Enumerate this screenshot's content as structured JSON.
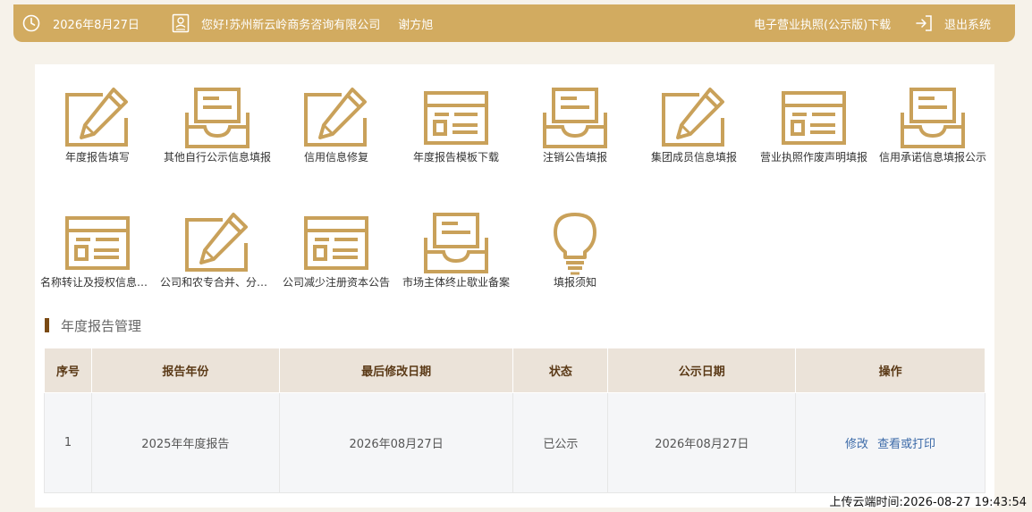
{
  "header": {
    "date": "2026年8月27日",
    "greeting": "您好!苏州新云岭商务咨询有限公司",
    "user_name": "谢方旭",
    "license_download": "电子营业执照(公示版)下载",
    "logout": "退出系统"
  },
  "tiles": [
    {
      "label": "年度报告填写",
      "icon": "pencil-icon"
    },
    {
      "label": "其他自行公示信息填报",
      "icon": "inbox-icon"
    },
    {
      "label": "信用信息修复",
      "icon": "pencil-icon"
    },
    {
      "label": "年度报告模板下载",
      "icon": "form-icon"
    },
    {
      "label": "注销公告填报",
      "icon": "inbox-icon"
    },
    {
      "label": "集团成员信息填报",
      "icon": "pencil-icon"
    },
    {
      "label": "营业执照作废声明填报",
      "icon": "form-icon"
    },
    {
      "label": "信用承诺信息填报公示",
      "icon": "inbox-icon"
    },
    {
      "label": "名称转让及授权信息填报",
      "icon": "form-icon"
    },
    {
      "label": "公司和农专合并、分立公告",
      "icon": "pencil-icon"
    },
    {
      "label": "公司减少注册资本公告",
      "icon": "form-icon"
    },
    {
      "label": "市场主体终止歇业备案",
      "icon": "inbox-icon"
    },
    {
      "label": "填报须知",
      "icon": "lightbulb-icon"
    }
  ],
  "section": {
    "title": "年度报告管理"
  },
  "table": {
    "headers": [
      "序号",
      "报告年份",
      "最后修改日期",
      "状态",
      "公示日期",
      "操作"
    ],
    "rows": [
      {
        "index": "1",
        "year": "2025年年度报告",
        "modified": "2026年08月27日",
        "status": "已公示",
        "publish_date": "2026年08月27日",
        "action_edit": "修改",
        "action_view": "查看或打印"
      }
    ]
  },
  "footer": {
    "upload_time": "上传云端时间:2026-08-27 19:43:54"
  },
  "colors": {
    "accent": "#d2ab60",
    "icon": "#c9a15a",
    "header_text": "#5b3a17",
    "link": "#3c6aa8"
  }
}
